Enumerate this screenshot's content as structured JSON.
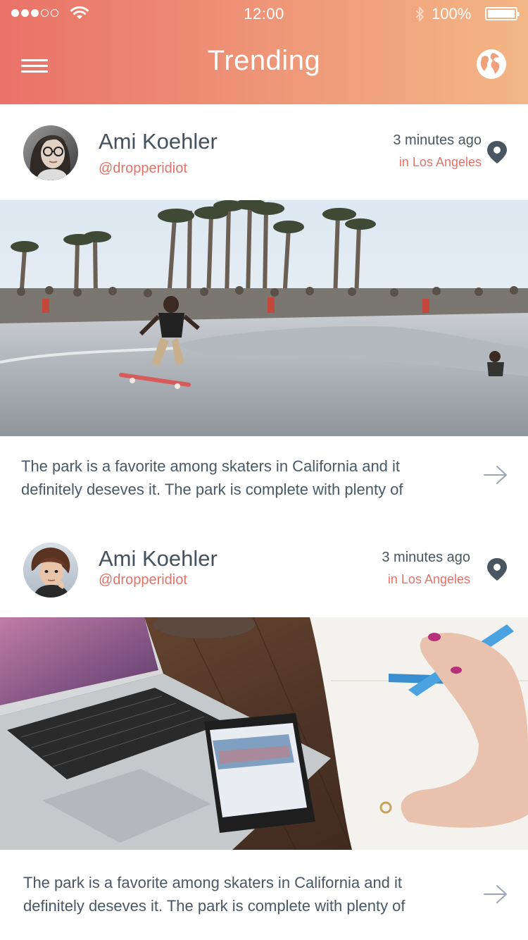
{
  "status_bar": {
    "time": "12:00",
    "battery": "100%",
    "signal_bars": 3,
    "signal_total": 5
  },
  "header": {
    "title": "Trending",
    "menu_icon": "hamburger-menu-icon",
    "globe_icon": "globe-icon"
  },
  "posts": [
    {
      "author": "Ami Koehler",
      "handle": "@dropperidiot",
      "time": "3 minutes ago",
      "location": "in Los Angeles",
      "image": "skatepark-photo",
      "text": "The park is a favorite among skaters in California and it definitely deseves it. The park is complete with plenty of"
    },
    {
      "author": "Ami Koehler",
      "handle": "@dropperidiot",
      "time": "3 minutes ago",
      "location": "in Los Angeles",
      "image": "desk-laptop-photo",
      "text": "The park is a favorite among skaters in California and it definitely deseves it. The park is complete with plenty of"
    }
  ],
  "colors": {
    "header_gradient_start": "#ea7268",
    "header_gradient_end": "#f3b685",
    "accent": "#e0746a",
    "text": "#4a5562"
  }
}
